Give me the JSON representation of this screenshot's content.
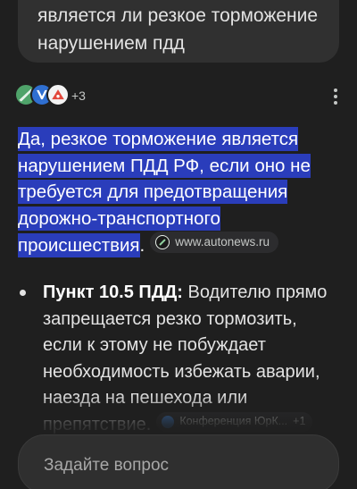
{
  "query": {
    "text": "является ли резкое торможение нарушением пдд"
  },
  "sources": {
    "icons": [
      "source-icon-1",
      "source-icon-2",
      "source-icon-3"
    ],
    "more_count": "+3",
    "menu_icon": "more-vert-icon"
  },
  "answer": {
    "highlighted": "Да, резкое торможение является нарушением ПДД РФ, если оно не требуется для предотвращения дорожно-транспортного происшествия",
    "trailing": ".",
    "source_chip": "www.autonews.ru"
  },
  "bullet": {
    "title": "Пункт 10.5 ПДД:",
    "text": " Водителю прямо запрещается резко тормозить, если к этому не побуждает необходимость избежать аварии, наезда на пешехода или препятствие.",
    "chip_label": "Конференция ЮрК...",
    "chip_more": "+1"
  },
  "ask": {
    "placeholder": "Задайте вопрос"
  },
  "colors": {
    "background": "#1f1f1f",
    "highlight": "#2a3dbb",
    "bubble": "#303030"
  }
}
